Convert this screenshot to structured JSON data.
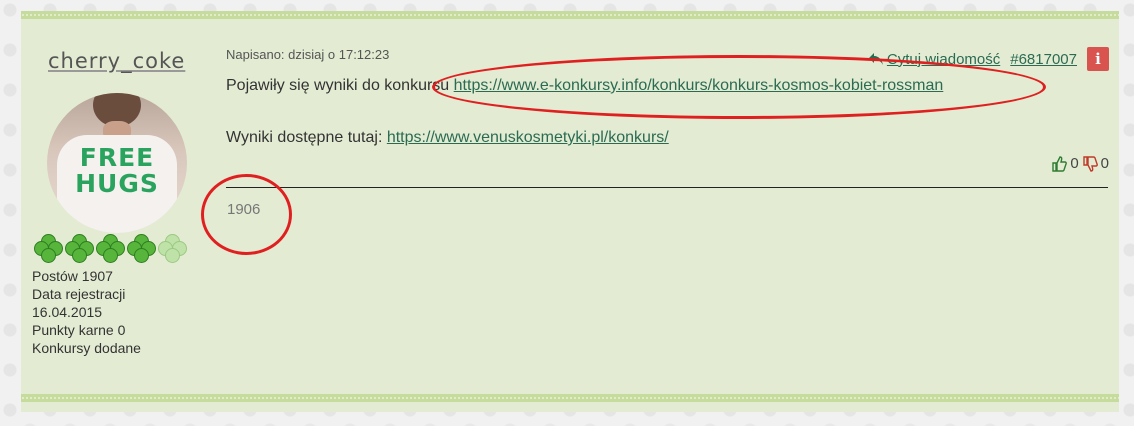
{
  "post": {
    "author": {
      "username": "cherry_coke",
      "avatar_text": "FREE HUGS",
      "rank_icons": [
        "clover-icon",
        "clover-icon",
        "clover-icon",
        "clover-icon",
        "clover-faded-icon"
      ],
      "posts": "Postów 1907",
      "registration_label": "Data rejestracji",
      "registration_date": "16.04.2015",
      "penalty_points": "Punkty karne 0",
      "contests_added": "Konkursy dodane"
    },
    "meta": {
      "posted": "Napisano: dzisiaj o 17:12:23",
      "quote_label": "Cytuj wiadomość",
      "post_number": "#6817007",
      "report_icon_text": "i"
    },
    "body": {
      "line1_text": "Pojawiły się wyniki do konkursu ",
      "line1_link": "https://www.e-konkursy.info/konkurs/konkurs-kosmos-kobiet-rossman",
      "line2_text": "Wyniki dostępne tutaj: ",
      "line2_link": "https://www.venuskosmetyki.pl/konkurs/"
    },
    "votes": {
      "up": "0",
      "down": "0"
    },
    "signature": "1906"
  },
  "colors": {
    "post_bg": "#e3ecd3",
    "bar": "#c6dc9c",
    "link": "#2a6b52",
    "annotation": "#e02020",
    "report": "#d9534f"
  }
}
